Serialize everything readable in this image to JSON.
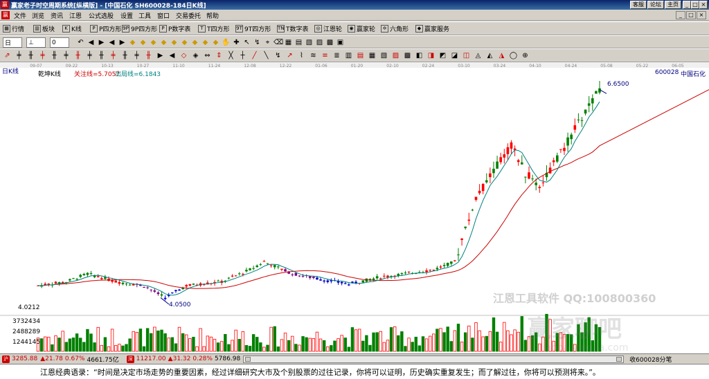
{
  "window": {
    "logo_char": "赢",
    "title": "赢家老子时空周期系统[纵横版] - [中国石化   SH600028-184日K线]",
    "buttons": [
      "客服",
      "论坛",
      "主页"
    ],
    "controls": [
      "_",
      "□",
      "×"
    ]
  },
  "menu": {
    "items": [
      "文件",
      "浏览",
      "资讯",
      "江恩",
      "公式选股",
      "设置",
      "工具",
      "窗口",
      "交易委托",
      "帮助"
    ],
    "window_controls": [
      "_",
      "□",
      "×"
    ]
  },
  "toolbar1": {
    "items": [
      {
        "icon": "▦",
        "label": "行情"
      },
      {
        "icon": "▥",
        "label": "板块"
      },
      {
        "icon": "K",
        "label": "K线"
      },
      {
        "icon": "P",
        "label": "P四方形"
      },
      {
        "icon": "9P",
        "label": "9P四方形"
      },
      {
        "icon": "P",
        "label": "P数字表"
      },
      {
        "icon": "T",
        "label": "T四方形"
      },
      {
        "icon": "9T",
        "label": "9T四方形"
      },
      {
        "icon": "TN",
        "label": "T数字表"
      },
      {
        "icon": "◎",
        "label": "江恩轮"
      },
      {
        "icon": "◉",
        "label": "赢家轮"
      },
      {
        "icon": "✡",
        "label": "六角形"
      },
      {
        "icon": "◆",
        "label": "赢家服务"
      }
    ]
  },
  "toolbar2": {
    "dropdowns": [
      "日",
      "⊥",
      "0"
    ],
    "icons": [
      "↶",
      "◀",
      "▶",
      "◀",
      "▶",
      "◆",
      "◆",
      "◆",
      "◆",
      "◆",
      "◆",
      "◆",
      "◆",
      "◆",
      "✋",
      "✚",
      "↖",
      "↯",
      "⌖",
      "⌫",
      "▦",
      "▤",
      "▧",
      "▨",
      "▩",
      "▣"
    ]
  },
  "toolbar3": {
    "icons": [
      "⇗",
      "╪",
      "╫",
      "╪",
      "╫",
      "╪",
      "╫",
      "╪",
      "╫",
      "╪",
      "╫",
      "╪",
      "╫",
      "▶",
      "◀",
      "◇",
      "◈",
      "⇔",
      "⇕",
      "╳",
      "┼",
      "╱",
      "╲",
      "↯",
      "↗",
      "⌇",
      "≋",
      "≡",
      "≣",
      "▥",
      "▤",
      "▦",
      "▧",
      "▨",
      "▩",
      "◧",
      "◨",
      "◩",
      "◪",
      "◫",
      "◬",
      "◭",
      "◮",
      "◯",
      "⊕"
    ]
  },
  "chart": {
    "period_label": "日K线",
    "indicator_name": "乾坤K线",
    "watch_line": "关注线=5.7057",
    "exit_line": "出局线=6.1843",
    "stock_code": "600028",
    "stock_name": "中国石化",
    "high_mark": "6.6500",
    "low_mark": "4.0500",
    "axis_left": "4.0212",
    "vol_axis": [
      "3732434",
      "2488289",
      "1244145"
    ],
    "date_ticks": [
      "09-07",
      "09-22",
      "10-13",
      "10-27",
      "11-10",
      "11-24",
      "12-08",
      "12-22",
      "01-06",
      "01-20",
      "02-10",
      "02-24",
      "03-10",
      "03-24",
      "04-10",
      "04-24",
      "05-08",
      "05-22",
      "06-05"
    ],
    "watermark": "江恩工具软件  QQ:100800360",
    "watermark2": "赢家聊吧",
    "watermark3": "liaoba.yingjia.com",
    "colors": {
      "up": "#ff0000",
      "down": "#008000",
      "purple": "#800080",
      "blue": "#0000cc",
      "ma_slow": "#cc0000",
      "ma_fast": "#008080"
    }
  },
  "status": {
    "sh_mark": "沪",
    "sh_index": "3285.88",
    "sh_change": "▲21.78",
    "sh_pct": "0.67%",
    "sh_amount": "4661.75亿",
    "sz_mark": "深",
    "sz_index": "11217.00",
    "sz_change": "▲31.32",
    "sz_pct": "0.28%",
    "sz_amount": "5786.98",
    "right_text": "收600028分笔"
  },
  "footer": {
    "quote": "江恩经典语录：“时间是决定市场走势的重要因素，经过详细研究大市及个别股票的过往记录，你将可以证明，历史确实重复发生；而了解过往，你将可以预测将来。”。"
  }
}
